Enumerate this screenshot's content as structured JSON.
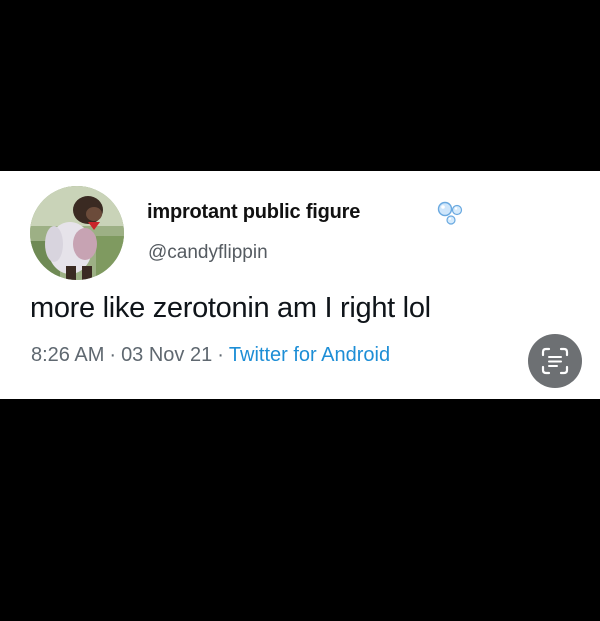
{
  "tweet": {
    "display_name": "improtant public figure",
    "handle": "@candyflippin",
    "text": "more like zerotonin am I right lol",
    "time": "8:26 AM",
    "date": "03 Nov 21",
    "source": "Twitter for Android",
    "separator": "·"
  },
  "icons": {
    "name_badge": "bubbles-icon",
    "lens": "lens-scan-icon",
    "avatar": "monkey-avatar"
  },
  "colors": {
    "background": "#000000",
    "card": "#ffffff",
    "source_link": "#1d8ed6",
    "muted_text": "#5f6870",
    "lens_button": "#6d7073"
  }
}
